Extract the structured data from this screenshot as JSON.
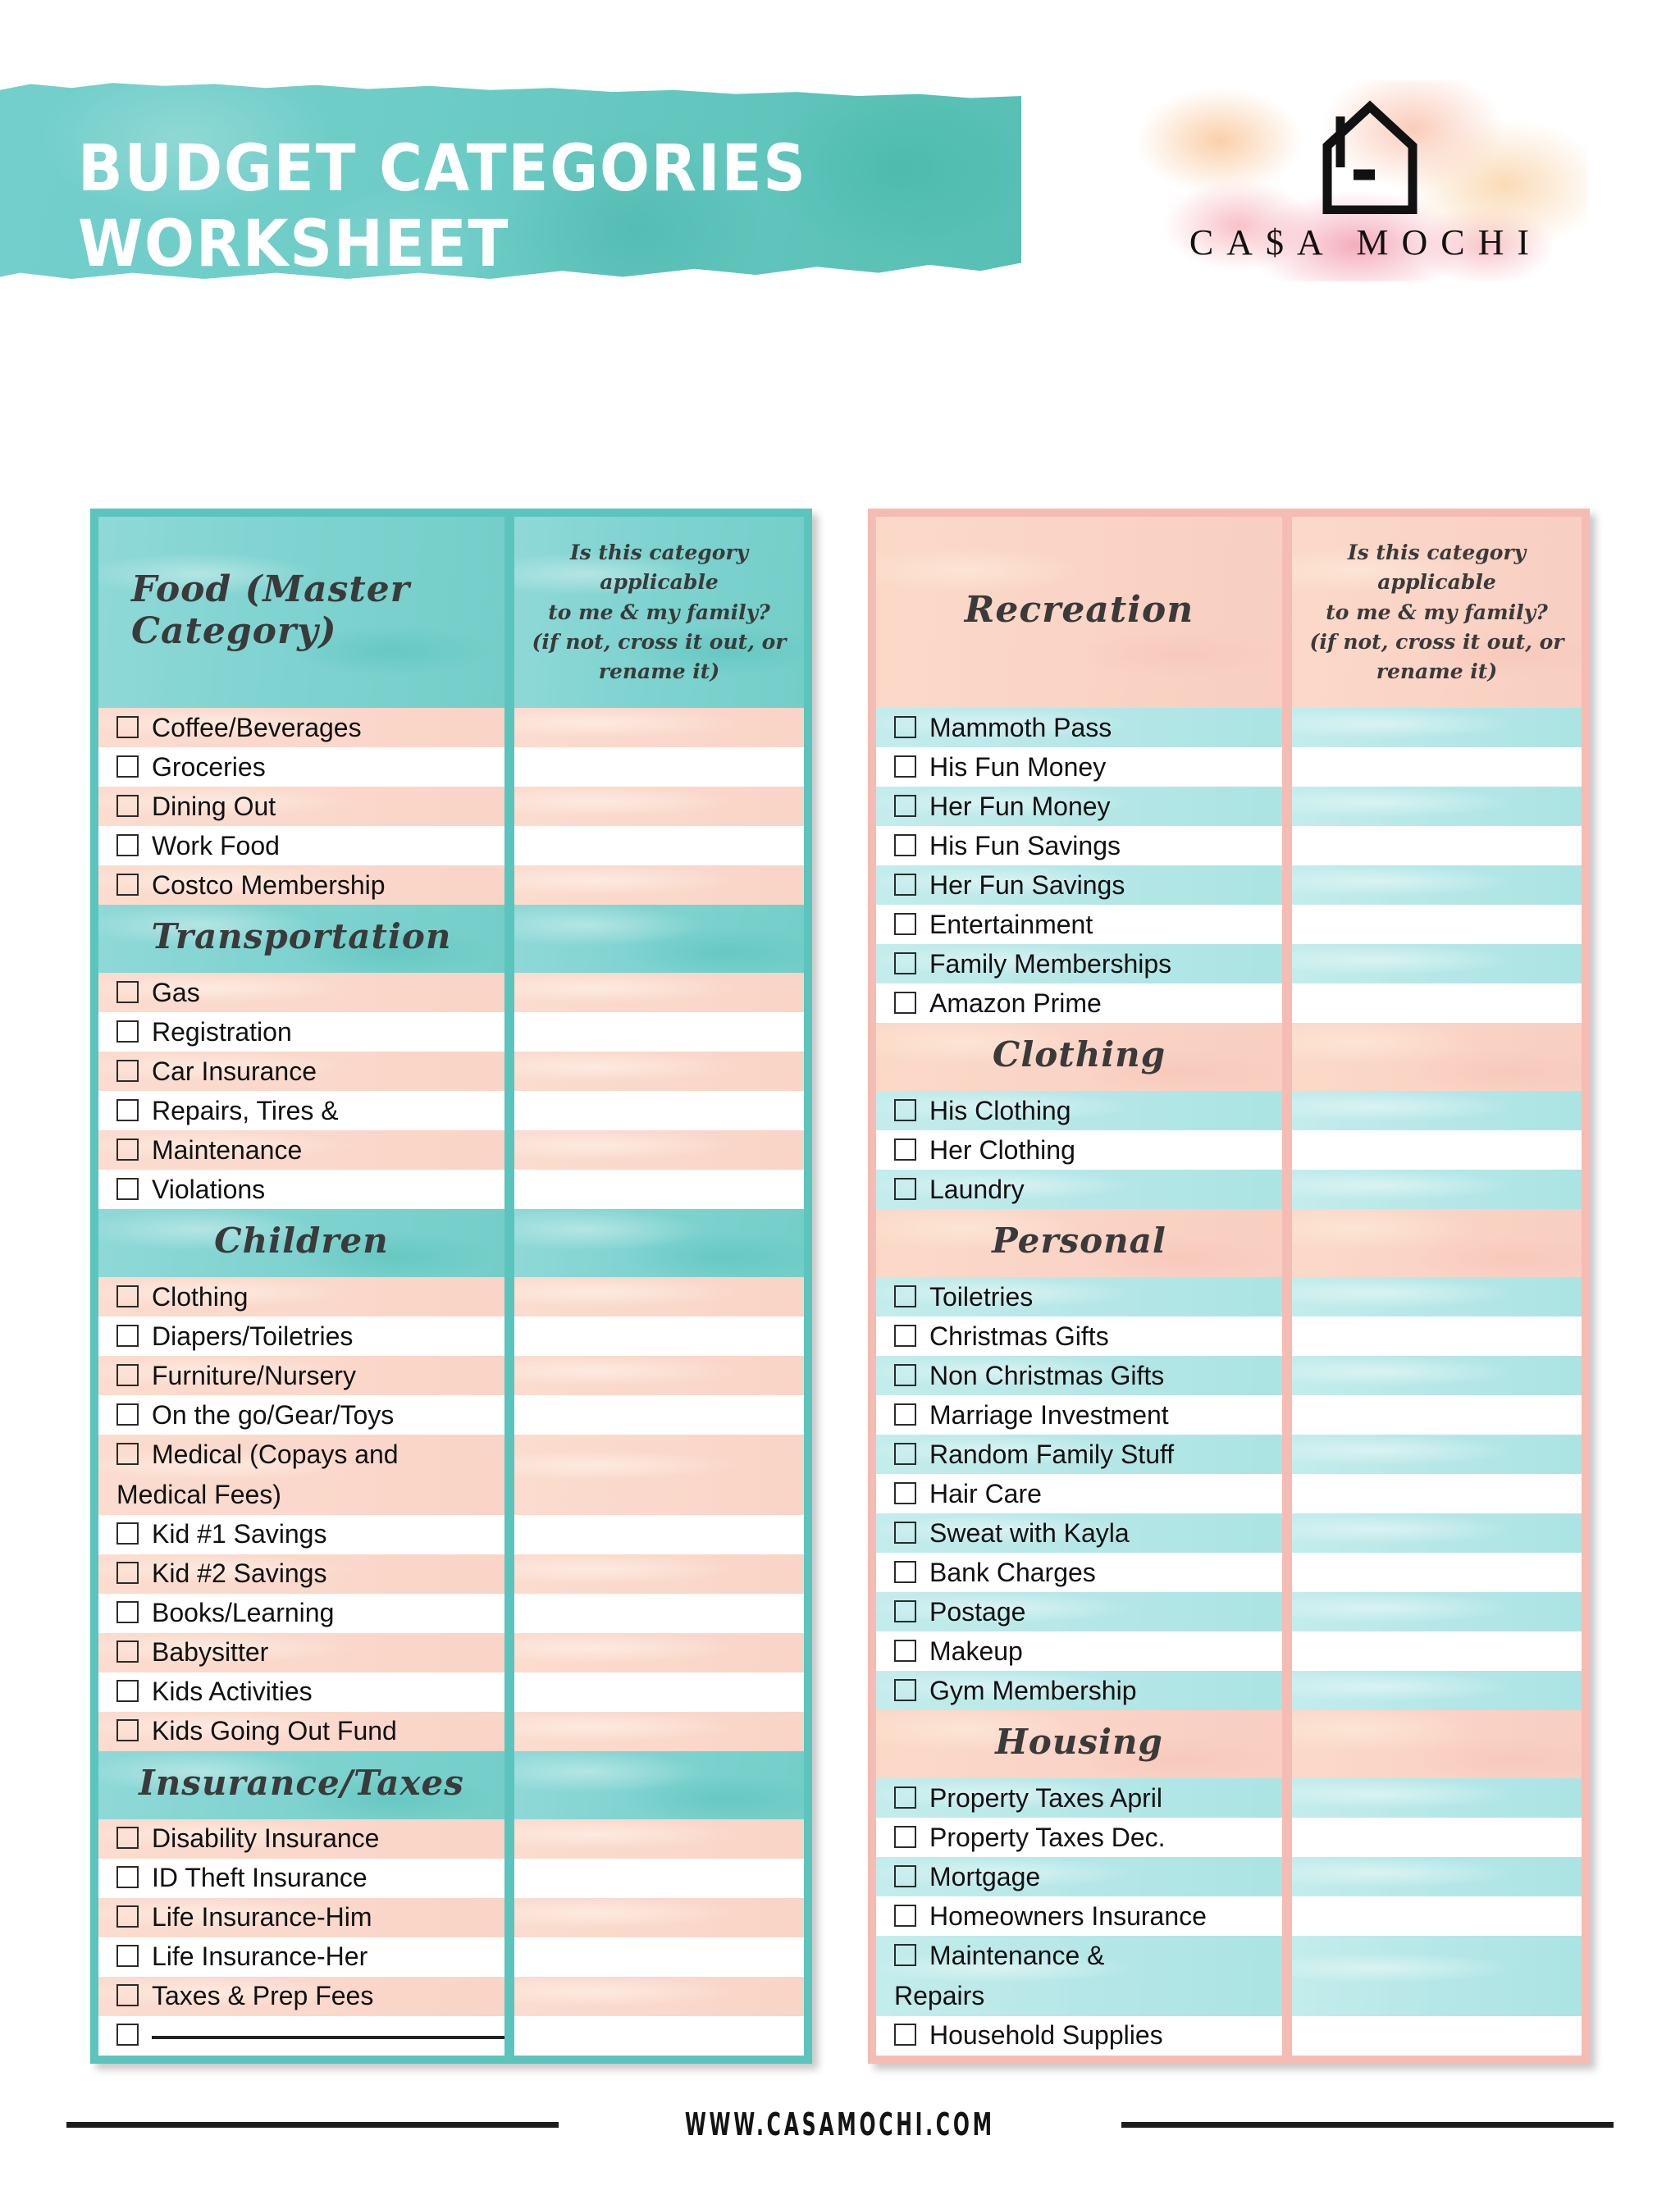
{
  "header": {
    "title": "Budget Categories\nWorksheet",
    "banner_color": "#6fcdc8"
  },
  "logo": {
    "brand": "CA$A MOCHI",
    "icon": "house-icon",
    "blob_colors": [
      "#facda5",
      "#f3a0b2",
      "#f6b2ba"
    ]
  },
  "question_prompt": "Is this category applicable\nto me & my family?\n(if not, cross it out, or rename it)",
  "left_table": {
    "accent": "#5bc4bd",
    "sections": [
      {
        "title": "Food (Master Category)",
        "title_style": "big",
        "items": [
          {
            "label": "Coffee/Beverages"
          },
          {
            "label": "Groceries"
          },
          {
            "label": "Dining Out"
          },
          {
            "label": "Work Food"
          },
          {
            "label": "Costco Membership"
          }
        ]
      },
      {
        "title": "Transportation",
        "items": [
          {
            "label": "Gas"
          },
          {
            "label": "Registration"
          },
          {
            "label": "Car Insurance"
          },
          {
            "label": "Repairs, Tires &"
          },
          {
            "label": "Maintenance"
          },
          {
            "label": "Violations"
          }
        ]
      },
      {
        "title": "Children",
        "items": [
          {
            "label": "Clothing"
          },
          {
            "label": "Diapers/Toiletries"
          },
          {
            "label": "Furniture/Nursery"
          },
          {
            "label": "On the go/Gear/Toys"
          },
          {
            "label": "Medical (Copays and\nMedical Fees)",
            "tall": true
          },
          {
            "label": "Kid #1 Savings"
          },
          {
            "label": "Kid #2 Savings"
          },
          {
            "label": "Books/Learning"
          },
          {
            "label": "Babysitter"
          },
          {
            "label": "Kids Activities"
          },
          {
            "label": "Kids Going Out Fund"
          }
        ]
      },
      {
        "title": "Insurance/Taxes",
        "items": [
          {
            "label": "Disability Insurance"
          },
          {
            "label": "ID Theft Insurance"
          },
          {
            "label": "Life Insurance-Him"
          },
          {
            "label": "Life Insurance-Her"
          },
          {
            "label": "Taxes & Prep Fees"
          },
          {
            "label": "",
            "writein": true
          }
        ]
      }
    ]
  },
  "right_table": {
    "accent": "#f5bcb3",
    "sections": [
      {
        "title": "Recreation",
        "title_style": "big",
        "items": [
          {
            "label": "Mammoth Pass"
          },
          {
            "label": "His Fun Money"
          },
          {
            "label": "Her Fun Money"
          },
          {
            "label": "His Fun Savings"
          },
          {
            "label": "Her Fun Savings"
          },
          {
            "label": "Entertainment"
          },
          {
            "label": "Family Memberships"
          },
          {
            "label": "Amazon Prime"
          }
        ]
      },
      {
        "title": "Clothing",
        "items": [
          {
            "label": "His Clothing"
          },
          {
            "label": "Her Clothing"
          },
          {
            "label": "Laundry"
          }
        ]
      },
      {
        "title": "Personal",
        "items": [
          {
            "label": "Toiletries"
          },
          {
            "label": "Christmas Gifts"
          },
          {
            "label": "Non Christmas Gifts"
          },
          {
            "label": "Marriage Investment"
          },
          {
            "label": "Random Family Stuff"
          },
          {
            "label": "Hair Care"
          },
          {
            "label": "Sweat with Kayla"
          },
          {
            "label": "Bank Charges"
          },
          {
            "label": "Postage"
          },
          {
            "label": "Makeup"
          },
          {
            "label": "Gym Membership"
          }
        ]
      },
      {
        "title": "Housing",
        "items": [
          {
            "label": "Property Taxes April"
          },
          {
            "label": "Property Taxes Dec."
          },
          {
            "label": "Mortgage"
          },
          {
            "label": "Homeowners Insurance"
          },
          {
            "label": "Maintenance &\nRepairs",
            "tall": true
          },
          {
            "label": "Household Supplies"
          }
        ]
      }
    ]
  },
  "footer": {
    "url": "WWW.CASAMOCHI.COM"
  }
}
